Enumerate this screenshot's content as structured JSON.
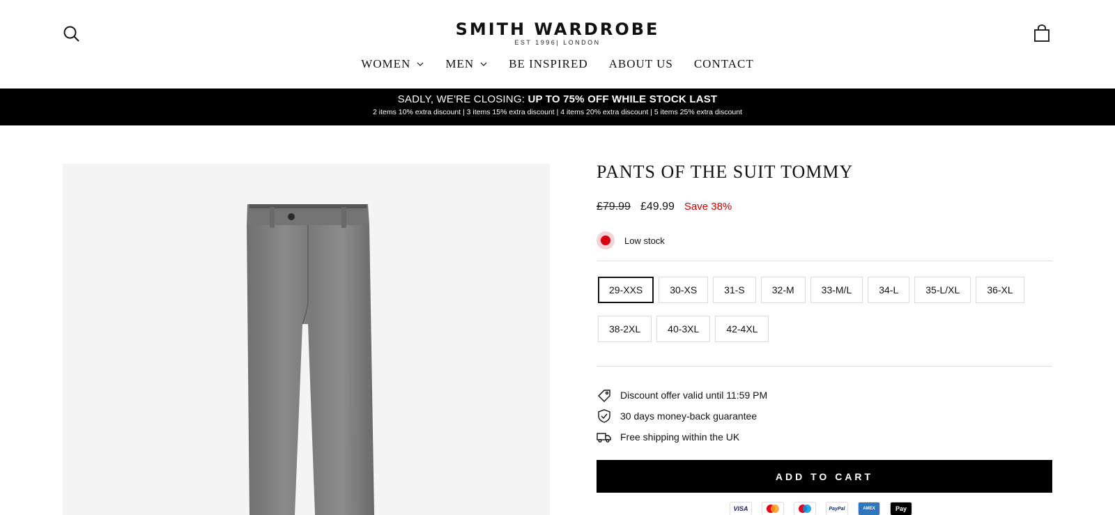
{
  "brand": {
    "name": "SMITH WARDROBE",
    "tagline": "EST 1996| LONDON"
  },
  "nav": {
    "items": [
      {
        "label": "WOMEN",
        "dropdown": true
      },
      {
        "label": "MEN",
        "dropdown": true
      },
      {
        "label": "BE INSPIRED",
        "dropdown": false
      },
      {
        "label": "ABOUT US",
        "dropdown": false
      },
      {
        "label": "CONTACT",
        "dropdown": false
      }
    ]
  },
  "icons": {
    "search": "search-icon",
    "cart": "cart-icon"
  },
  "announcement": {
    "prefix": "SADLY, WE'RE CLOSING: ",
    "highlight": "UP TO 75% OFF WHILE STOCK LAST",
    "discounts": "2 items 10% extra discount | 3 items 15% extra discount | 4 items 20% extra discount | 5 items 25% extra discount"
  },
  "product": {
    "title": "PANTS OF THE SUIT TOMMY",
    "price_old": "£79.99",
    "price_new": "£49.99",
    "save": "Save 38%",
    "stock": "Low stock",
    "sizes": [
      "29-XXS",
      "30-XS",
      "31-S",
      "32-M",
      "33-M/L",
      "34-L",
      "35-L/XL",
      "36-XL",
      "38-2XL",
      "40-3XL",
      "42-4XL"
    ],
    "selected_size": "29-XXS",
    "perks": [
      {
        "icon": "tag-icon",
        "text": "Discount offer valid until 11:59 PM"
      },
      {
        "icon": "shield-check-icon",
        "text": "30 days money-back guarantee"
      },
      {
        "icon": "truck-icon",
        "text": "Free shipping within the UK"
      }
    ],
    "add_to_cart": "ADD TO CART"
  },
  "payments": [
    "VISA",
    "mastercard",
    "maestro",
    "PayPal",
    "AMEX",
    "Pay"
  ],
  "colors": {
    "accent": "#000000",
    "sale": "#cc0000",
    "stock_dot": "#d90012",
    "image_bg": "#f4f4f4"
  }
}
